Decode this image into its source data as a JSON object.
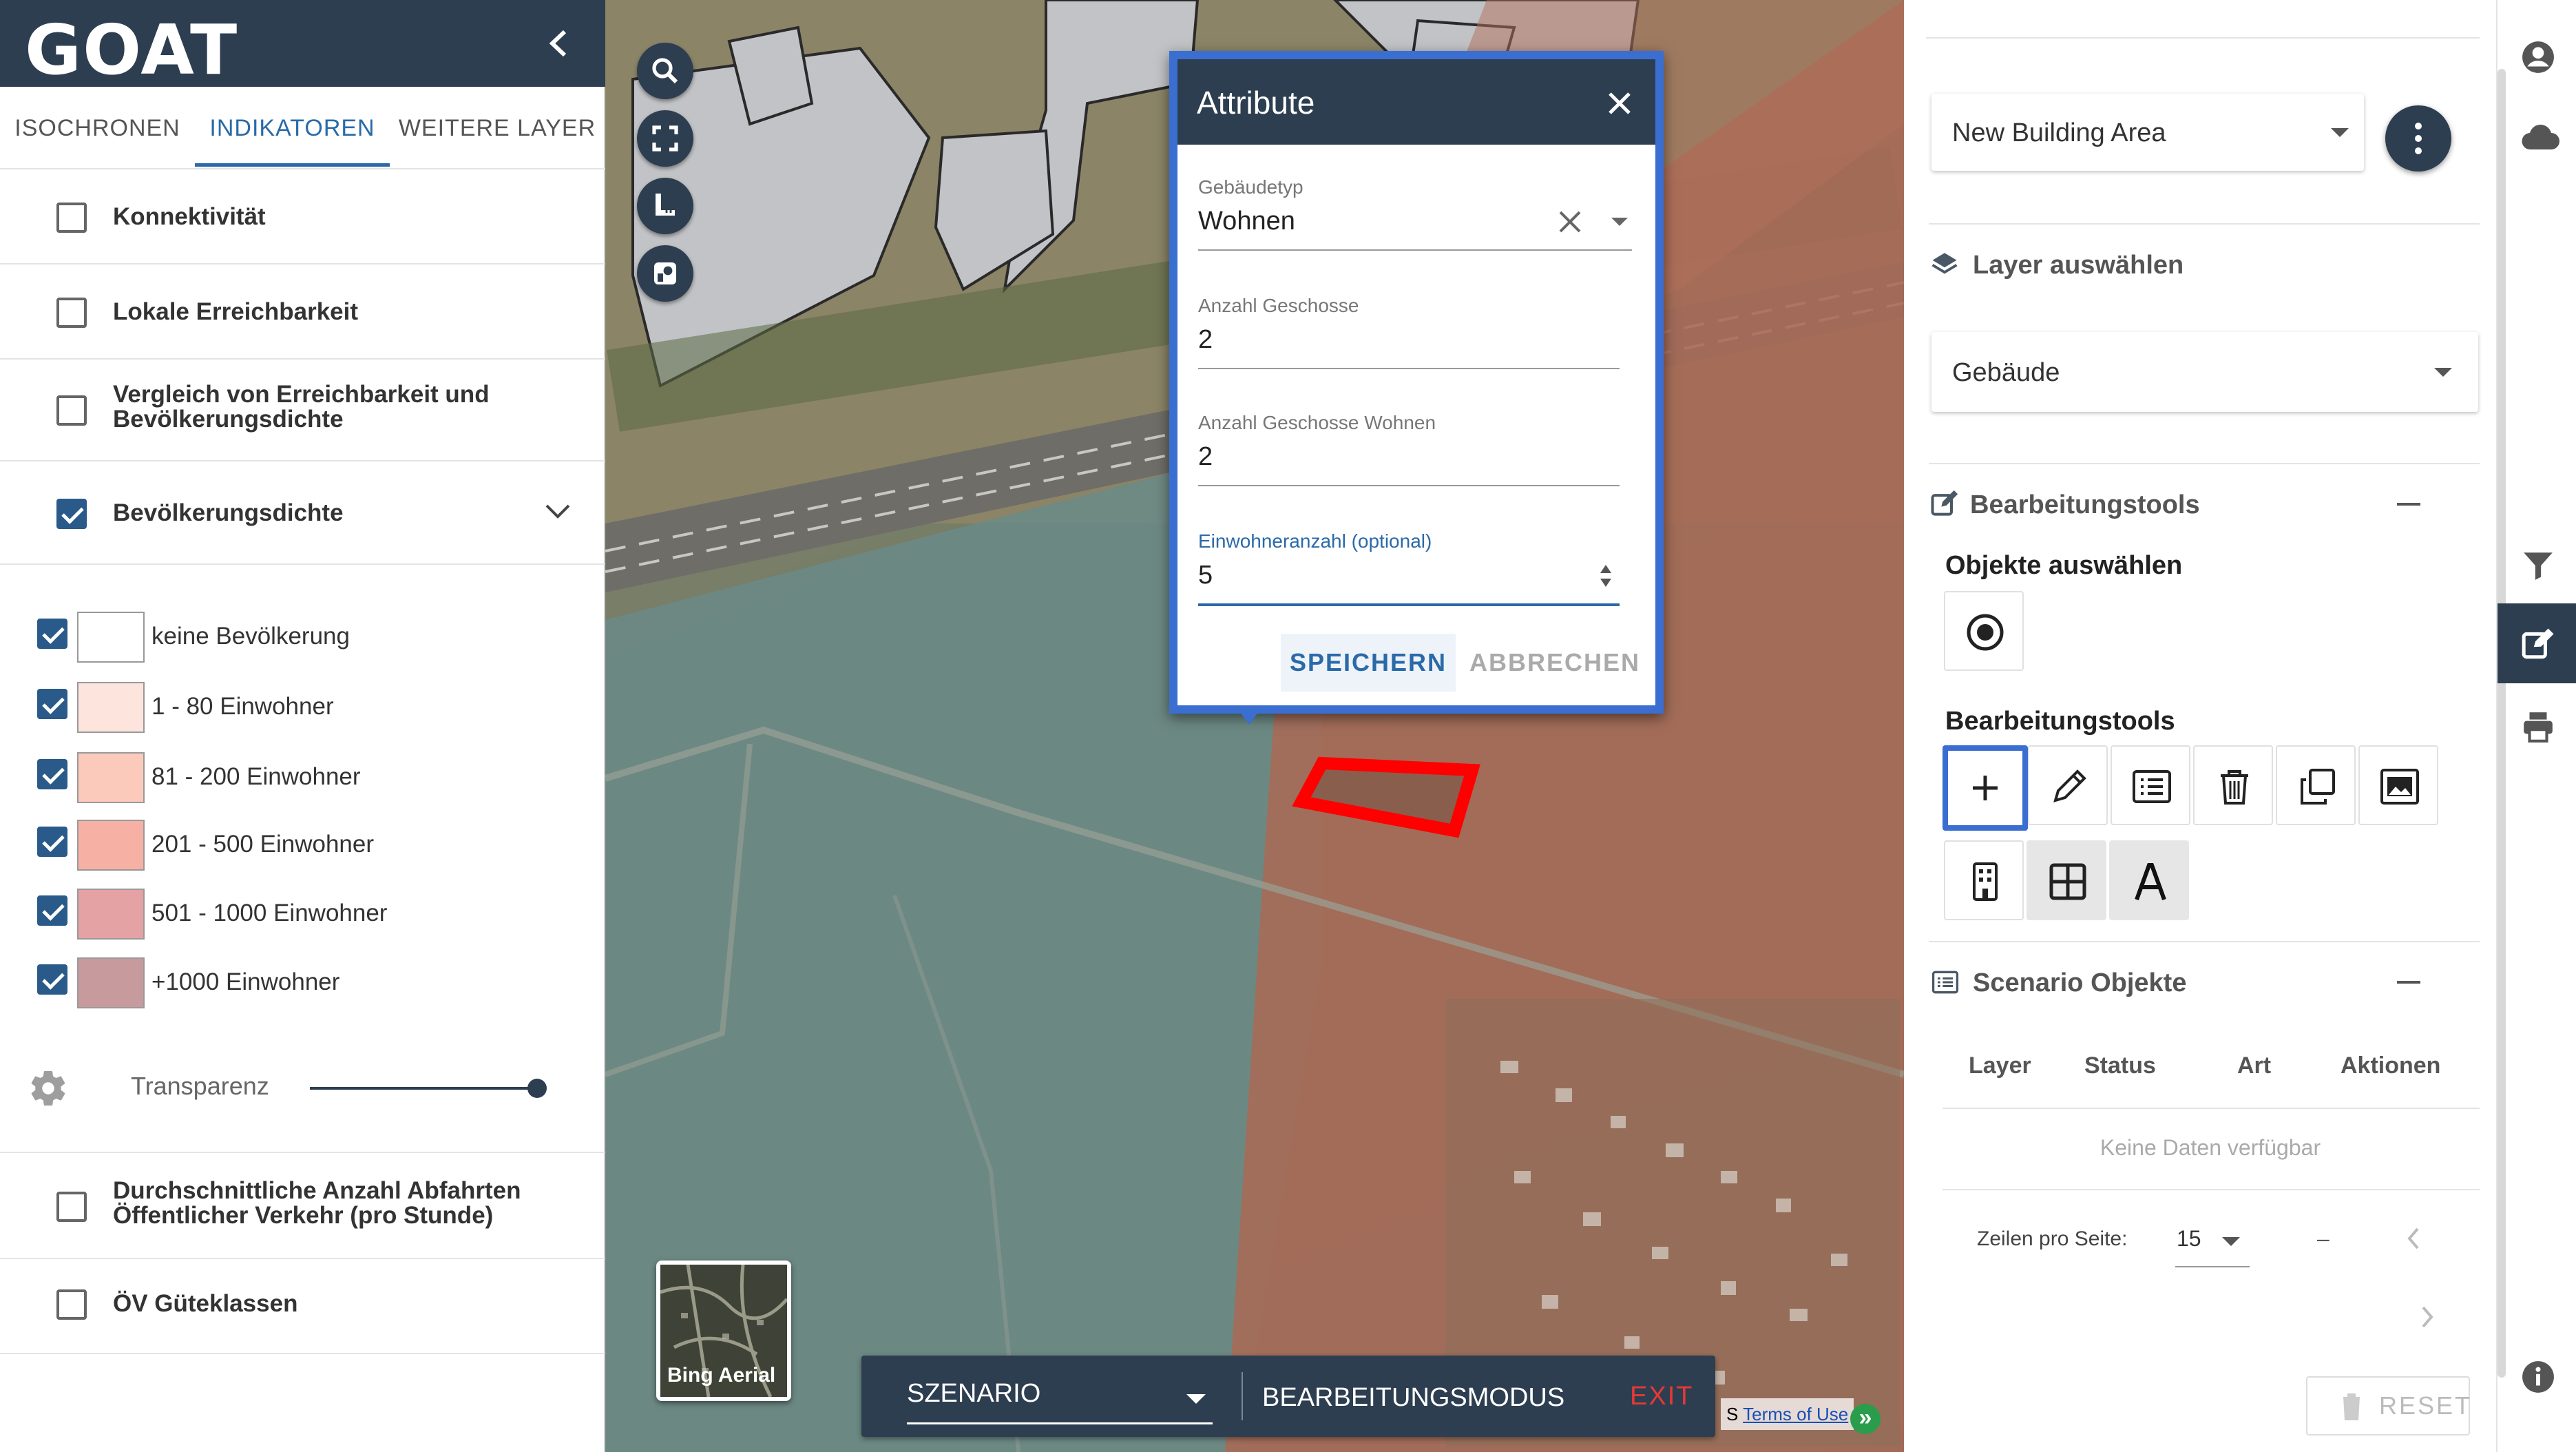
{
  "app": {
    "logo": "GOAT"
  },
  "tabs": [
    {
      "label": "ISOCHRONEN"
    },
    {
      "label": "INDIKATOREN"
    },
    {
      "label": "WEITERE LAYER"
    }
  ],
  "indicators": {
    "konnektivitaet": {
      "label": "Konnektivität",
      "checked": false
    },
    "lokale": {
      "label": "Lokale Erreichbarkeit",
      "checked": false
    },
    "vergleich": {
      "label1": "Vergleich von Erreichbarkeit und",
      "label2": "Bevölkerungsdichte",
      "checked": false
    },
    "bevoelkerung": {
      "label": "Bevölkerungsdichte",
      "checked": true
    },
    "abfahrten": {
      "label1": "Durchschnittliche Anzahl Abfahrten",
      "label2": "Öffentlicher Verkehr (pro Stunde)",
      "checked": false
    },
    "guete": {
      "label": "ÖV Güteklassen",
      "checked": false
    }
  },
  "legend": [
    {
      "label": "keine Bevölkerung",
      "color": "#ffffff"
    },
    {
      "label": "1 - 80 Einwohner",
      "color": "#fde4dc"
    },
    {
      "label": "81 - 200 Einwohner",
      "color": "#fbcaba"
    },
    {
      "label": "201 - 500 Einwohner",
      "color": "#f6b0a4"
    },
    {
      "label": "501 - 1000 Einwohner",
      "color": "#e4a2a4"
    },
    {
      "label": "+1000 Einwohner",
      "color": "#c79a9e"
    }
  ],
  "transparency": {
    "label": "Transparenz",
    "value_percent": 100
  },
  "map": {
    "basemap_label": "Bing Aerial",
    "attribution_prefix": "S",
    "attribution_link": "Terms of Use",
    "attribution_arrow": "»"
  },
  "bottombar": {
    "scenario": "SZENARIO",
    "mode": "BEARBEITUNGSMODUS",
    "exit": "EXIT"
  },
  "dialog": {
    "title": "Attribute",
    "fields": {
      "gebaeudetyp": {
        "label": "Gebäudetyp",
        "value": "Wohnen"
      },
      "geschosse": {
        "label": "Anzahl Geschosse",
        "value": "2"
      },
      "geschosse_wohnen": {
        "label": "Anzahl Geschosse Wohnen",
        "value": "2"
      },
      "einwohner": {
        "label": "Einwohneranzahl (optional)",
        "value": "5"
      }
    },
    "save": "SPEICHERN",
    "cancel": "ABBRECHEN"
  },
  "right": {
    "scenario_select": "New Building Area",
    "layer_section": "Layer auswählen",
    "layer_select": "Gebäude",
    "tools_section": "Bearbeitungstools",
    "select_objects": "Objekte auswählen",
    "tools_sub": "Bearbeitungstools",
    "objects_section": "Scenario Objekte",
    "table_headers": [
      "Layer",
      "Status",
      "Art",
      "Aktionen"
    ],
    "no_data": "Keine Daten verfügbar",
    "rows_per_page_label": "Zeilen pro Seite:",
    "rows_per_page": "15",
    "range": "–",
    "reset": "RESET"
  },
  "colors": {
    "navy": "#2d3e50",
    "accent": "#2a6aa8",
    "dialog_border": "#3b6ed1",
    "exit_red": "#e53935",
    "highlight_red": "#ff0000"
  }
}
